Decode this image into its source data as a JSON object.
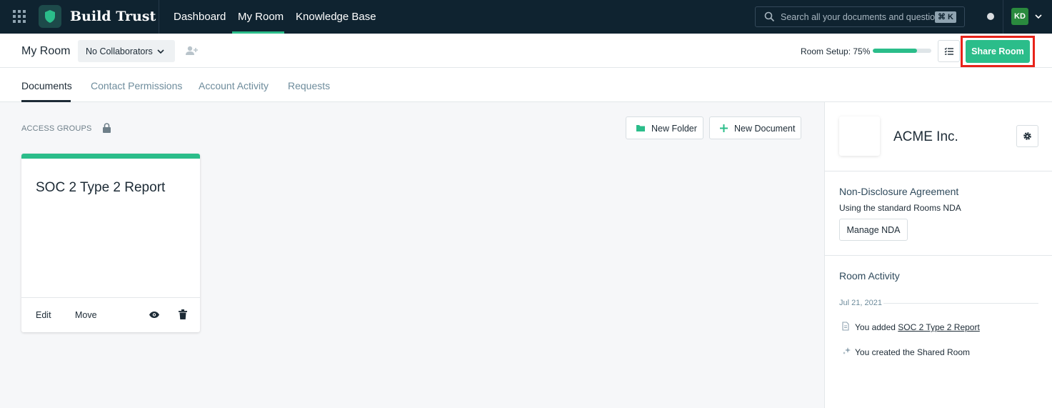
{
  "app": {
    "brand": "Build Trust",
    "accent": "#2bbd8a",
    "nav_bg": "#0f2330",
    "highlight": "#e8231a"
  },
  "topnav": {
    "items": [
      {
        "label": "Dashboard",
        "active": false
      },
      {
        "label": "My Room",
        "active": true
      },
      {
        "label": "Knowledge Base",
        "active": false
      }
    ],
    "search": {
      "placeholder": "Search all your documents and questions",
      "shortcut": "⌘ K"
    },
    "avatar_initials": "KD"
  },
  "subheader": {
    "title": "My Room",
    "collaborators_label": "No Collaborators",
    "setup_label": "Room Setup: 75%",
    "setup_progress": 0.75,
    "share_label": "Share Room"
  },
  "tabs": [
    {
      "label": "Documents",
      "active": true
    },
    {
      "label": "Contact Permissions",
      "active": false
    },
    {
      "label": "Account Activity",
      "active": false
    },
    {
      "label": "Requests",
      "active": false
    }
  ],
  "main": {
    "access_groups_label": "ACCESS GROUPS",
    "new_folder_label": "New Folder",
    "new_document_label": "New Document",
    "cards": [
      {
        "title": "SOC 2 Type 2 Report",
        "edit_label": "Edit",
        "move_label": "Move"
      }
    ]
  },
  "panel": {
    "company_name": "ACME Inc.",
    "nda": {
      "title": "Non-Disclosure Agreement",
      "subtitle": "Using the standard Rooms NDA",
      "button_label": "Manage NDA"
    },
    "activity": {
      "title": "Room Activity",
      "date": "Jul 21, 2021",
      "items": [
        {
          "prefix": "You added ",
          "link": "SOC 2 Type 2 Report",
          "icon": "document-icon"
        },
        {
          "prefix": "You created the Shared Room",
          "link": "",
          "icon": "sparkle-icon"
        }
      ]
    }
  }
}
